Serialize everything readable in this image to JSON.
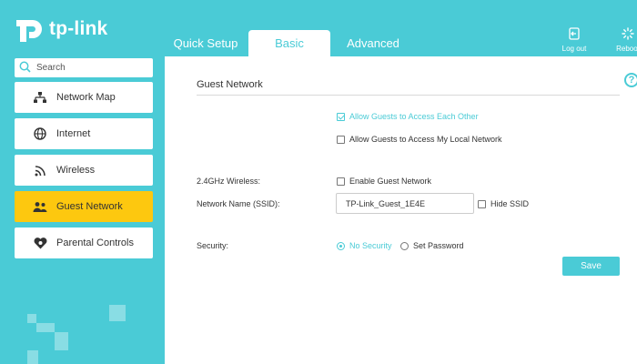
{
  "header": {
    "logo_text": "tp-link",
    "tabs": [
      {
        "label": "Quick Setup"
      },
      {
        "label": "Basic"
      },
      {
        "label": "Advanced"
      }
    ],
    "logout_label": "Log out",
    "reboot_label": "Reboot"
  },
  "sidebar": {
    "search_placeholder": "Search",
    "items": [
      {
        "label": "Network Map",
        "icon": "network-map-icon"
      },
      {
        "label": "Internet",
        "icon": "globe-icon"
      },
      {
        "label": "Wireless",
        "icon": "wireless-icon"
      },
      {
        "label": "Guest Network",
        "icon": "guest-network-icon",
        "active": true
      },
      {
        "label": "Parental Controls",
        "icon": "parental-controls-icon"
      }
    ]
  },
  "main": {
    "section_title": "Guest Network",
    "allow_each_other_label": "Allow Guests to Access Each Other",
    "allow_each_other_checked": true,
    "allow_local_label": "Allow Guests to Access My Local Network",
    "allow_local_checked": false,
    "wireless_label": "2.4GHz Wireless:",
    "enable_guest_label": "Enable Guest Network",
    "enable_guest_checked": false,
    "ssid_label": "Network Name (SSID):",
    "ssid_value": "TP-Link_Guest_1E4E",
    "hide_ssid_label": "Hide SSID",
    "hide_ssid_checked": false,
    "security_label": "Security:",
    "security_options": [
      {
        "label": "No Security",
        "selected": true
      },
      {
        "label": "Set Password",
        "selected": false
      }
    ],
    "save_label": "Save",
    "help_label": "?"
  },
  "colors": {
    "brand": "#4acbd6",
    "active_nav": "#fdc80f"
  }
}
